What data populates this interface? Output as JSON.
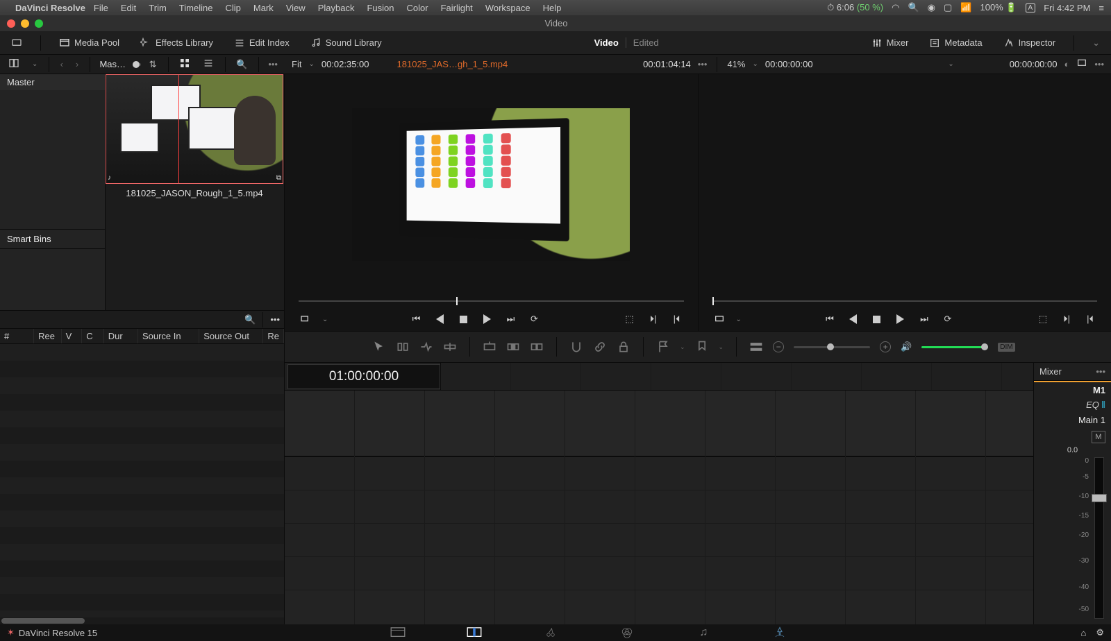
{
  "mac": {
    "app": "DaVinci Resolve",
    "menus": [
      "File",
      "Edit",
      "Trim",
      "Timeline",
      "Clip",
      "Mark",
      "View",
      "Playback",
      "Fusion",
      "Color",
      "Fairlight",
      "Workspace",
      "Help"
    ],
    "timer": "6:06",
    "timer_pct": "(50 %)",
    "battery": "100%",
    "clock": "Fri 4:42 PM",
    "account_badge": "A"
  },
  "window": {
    "title": "Video"
  },
  "panels": {
    "media_pool": "Media Pool",
    "effects": "Effects Library",
    "edit_index": "Edit Index",
    "sound": "Sound Library",
    "mixer": "Mixer",
    "metadata": "Metadata",
    "inspector": "Inspector",
    "project": "Video",
    "edited": "Edited"
  },
  "mp": {
    "breadcrumb": "Mas…",
    "tree_root": "Master",
    "smart_bins": "Smart Bins",
    "clip_name": "181025_JASON_Rough_1_5.mp4"
  },
  "src_viewer": {
    "fit": "Fit",
    "duration": "00:02:35:00",
    "clip": "181025_JAS…gh_1_5.mp4",
    "tc": "00:01:04:14",
    "zoom": "41%",
    "playhead_pct": 41
  },
  "rec_viewer": {
    "tc_left": "00:00:00:00",
    "tc_right": "00:00:00:00",
    "playhead_pct": 0
  },
  "edit_index_cols": [
    "#",
    "Ree",
    "V",
    "C",
    "Dur",
    "Source In",
    "Source Out",
    "Re"
  ],
  "timeline": {
    "tc": "01:00:00:00"
  },
  "toolbar": {
    "dim": "DIM"
  },
  "mixer": {
    "title": "Mixer",
    "strip": "M1",
    "eq": "EQ",
    "bus": "Main 1",
    "mute": "M",
    "db": "0.0",
    "scale": [
      "0",
      "-5",
      "-10",
      "-15",
      "-20",
      "-30",
      "-40",
      "-50"
    ]
  },
  "footer": {
    "brand": "DaVinci Resolve 15"
  }
}
